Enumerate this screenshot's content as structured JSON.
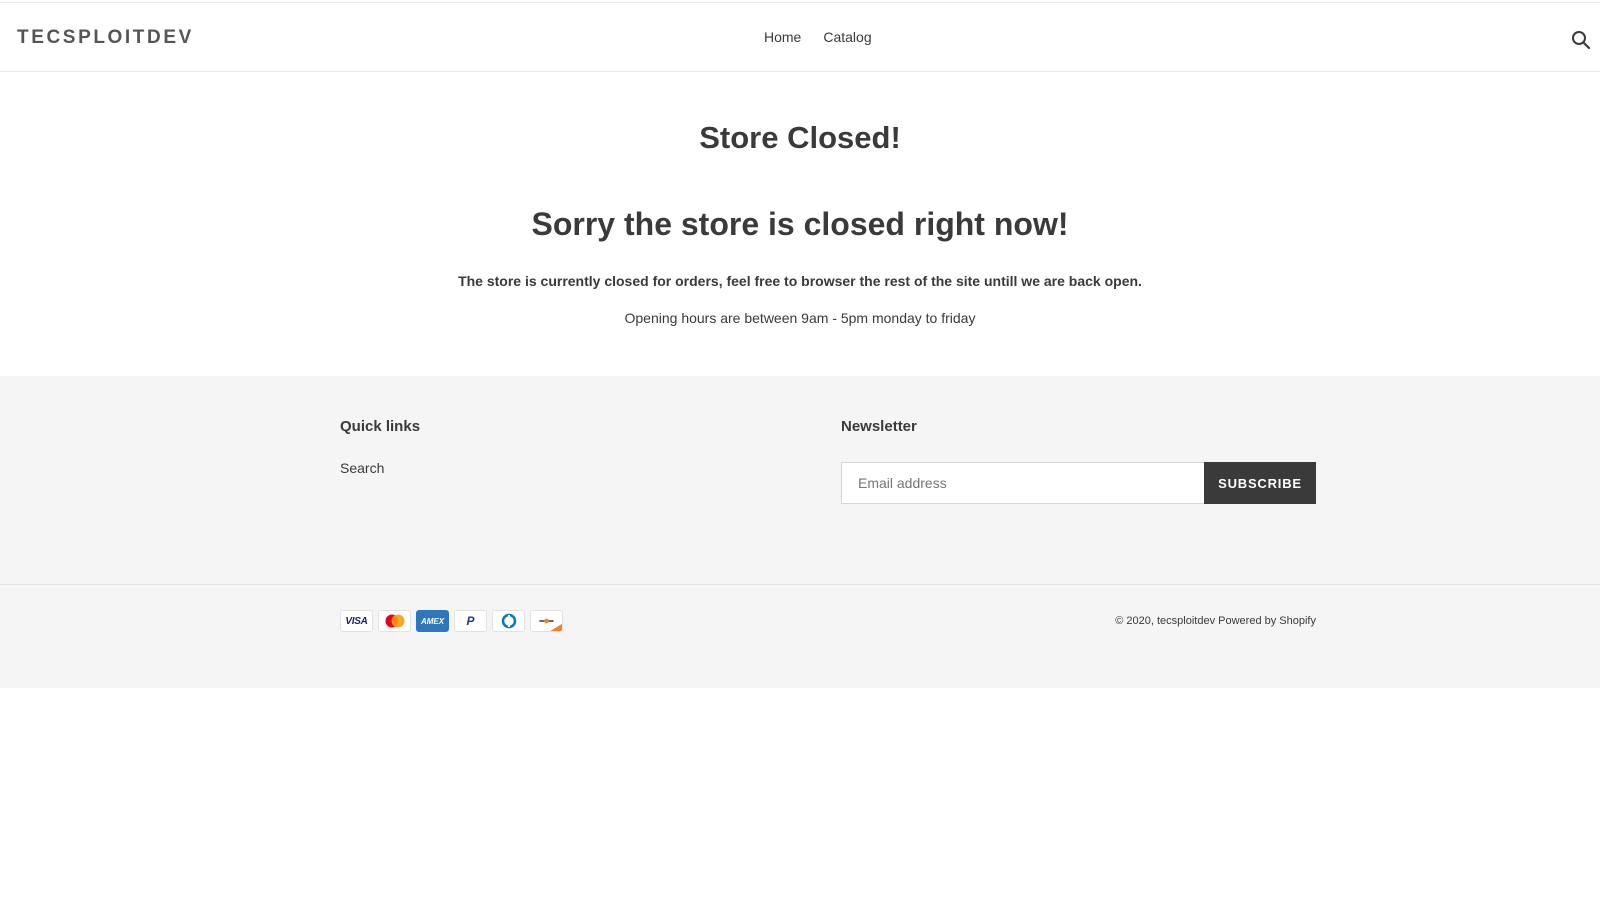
{
  "header": {
    "logo": "TECSPLOITDEV",
    "nav": [
      {
        "label": "Home"
      },
      {
        "label": "Catalog"
      }
    ],
    "search_icon": "search-icon"
  },
  "main": {
    "title": "Store Closed!",
    "subtitle": "Sorry the store is closed right now!",
    "message_bold": "The store is currently closed for orders, feel free to browser the rest of the site untill we are back open.",
    "message": "Opening hours are between 9am - 5pm monday to friday"
  },
  "footer": {
    "quick_links": {
      "title": "Quick links",
      "items": [
        {
          "label": "Search"
        }
      ]
    },
    "newsletter": {
      "title": "Newsletter",
      "email_placeholder": "Email address",
      "email_value": "",
      "subscribe_label": "SUBSCRIBE"
    },
    "payment_icons": [
      {
        "name": "visa-icon",
        "label": "VISA"
      },
      {
        "name": "mastercard-icon",
        "label": ""
      },
      {
        "name": "amex-icon",
        "label": "AMEX"
      },
      {
        "name": "paypal-icon",
        "label": "P"
      },
      {
        "name": "diners-club-icon",
        "label": ""
      },
      {
        "name": "discover-icon",
        "label": ""
      }
    ],
    "copyright_prefix": "© 2020,",
    "store_link": "tecsploitdev",
    "powered_by": "Powered by Shopify"
  },
  "colors": {
    "text": "#3a3a3a",
    "footer_bg": "#f5f5f5",
    "button_bg": "#3a3a3a",
    "amex_blue": "#2e77bc",
    "mastercard_red": "#eb001b",
    "mastercard_orange": "#f79e1b"
  }
}
